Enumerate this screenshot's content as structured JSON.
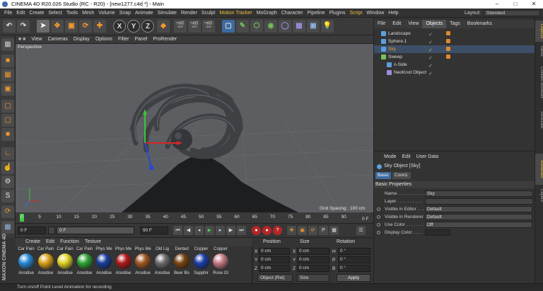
{
  "title": "CINEMA 4D R20.026 Studio (RC - R20) - [new1277.c4d *] - Main",
  "window_controls": {
    "min": "–",
    "max": "□",
    "close": "✕"
  },
  "menu": [
    "File",
    "Edit",
    "Create",
    "Select",
    "Tools",
    "Mesh",
    "Volume",
    "Snap",
    "Animate",
    "Simulate",
    "Render",
    "Sculpt",
    "Motion Tracker",
    "MoGraph",
    "Character",
    "Pipeline",
    "Plugins",
    "Script",
    "Window",
    "Help"
  ],
  "layout": {
    "label": "Layout:",
    "value": "Standard"
  },
  "viewport": {
    "menu": [
      "View",
      "Cameras",
      "Display",
      "Options",
      "Filter",
      "Panel",
      "ProRender"
    ],
    "camera": "Perspective",
    "grid_spacing": "Grid Spacing : 100 cm"
  },
  "timeline": {
    "ticks": [
      "0",
      "5",
      "10",
      "15",
      "20",
      "25",
      "30",
      "35",
      "40",
      "45",
      "50",
      "55",
      "60",
      "65",
      "70",
      "75",
      "80",
      "85",
      "90"
    ],
    "end_label": "0 F"
  },
  "transport": {
    "start": "0 F",
    "current": "0 F",
    "end": "90 F",
    "end2": "90 F"
  },
  "materials": {
    "menu": [
      "Create",
      "Edit",
      "Function",
      "Texture"
    ],
    "items": [
      {
        "top": "Car Pain",
        "bottom": "Anodise",
        "color": "#2a8ad6"
      },
      {
        "top": "Car Pain",
        "bottom": "Anodise",
        "color": "#d8a11a"
      },
      {
        "top": "Car Pain",
        "bottom": "Anodise",
        "color": "#e0d326"
      },
      {
        "top": "Car Pain",
        "bottom": "Anodise",
        "color": "#2fa535"
      },
      {
        "top": "Phys Me",
        "bottom": "Anodise",
        "color": "#1a3e9c"
      },
      {
        "top": "Phys Me",
        "bottom": "Anodise",
        "color": "#b01b1b"
      },
      {
        "top": "Phys Me",
        "bottom": "Anodise",
        "color": "#a25822"
      },
      {
        "top": "Old Lig",
        "bottom": "Anodise",
        "color": "#6d6d6d"
      },
      {
        "top": "Dented",
        "bottom": "Beer Bo",
        "color": "#7a4412"
      },
      {
        "top": "Copper",
        "bottom": "Sapphir",
        "color": "#1c3fa8"
      },
      {
        "top": "Copper",
        "bottom": "Rose Gl",
        "color": "#c47a86"
      }
    ]
  },
  "coords": {
    "headers": {
      "position": "Position",
      "size": "Size",
      "rotation": "Rotation"
    },
    "rows": [
      {
        "axis": "X",
        "pos": "0 cm",
        "size_axis": "X",
        "size": "0 cm",
        "rot_axis": "H",
        "rot": "0 °"
      },
      {
        "axis": "Y",
        "pos": "0 cm",
        "size_axis": "Y",
        "size": "0 cm",
        "rot_axis": "P",
        "rot": "0 °"
      },
      {
        "axis": "Z",
        "pos": "0 cm",
        "size_axis": "Z",
        "size": "0 cm",
        "rot_axis": "B",
        "rot": "0 °"
      }
    ],
    "mode": "Object (Rel)",
    "size_mode": "Size",
    "apply": "Apply"
  },
  "objects": {
    "menu": [
      "File",
      "Edit",
      "View",
      "Objects",
      "Tags",
      "Bookmarks"
    ],
    "active_tab": "Objects",
    "items": [
      {
        "name": "Landscape",
        "indent": 0,
        "icon_color": "#5aa0e0"
      },
      {
        "name": "Sphere.1",
        "indent": 0,
        "icon_color": "#5aa0e0"
      },
      {
        "name": "Sky",
        "indent": 0,
        "icon_color": "#5aa0e0",
        "selected": true
      },
      {
        "name": "Sweep",
        "indent": 0,
        "icon_color": "#78c25b"
      },
      {
        "name": "n-Side",
        "indent": 1,
        "icon_color": "#5aa0e0"
      },
      {
        "name": "NeoKnot Object",
        "indent": 1,
        "icon_color": "#9c8ce0"
      }
    ]
  },
  "attributes": {
    "menu": [
      "Mode",
      "Edit",
      "User Data"
    ],
    "object_title": "Sky Object [Sky]",
    "tabs": [
      "Basic",
      "Coord."
    ],
    "section": "Basic Properties",
    "fields": [
      {
        "label": "Name . . . . . . . . . . .",
        "value": "Sky",
        "type": "text"
      },
      {
        "label": "Layer . . . . . . . . . .",
        "value": "",
        "type": "text"
      },
      {
        "label": "Visible in Editor . . .",
        "value": "Default",
        "type": "dropdown"
      },
      {
        "label": "Visible in Renderer",
        "value": "Default",
        "type": "dropdown"
      },
      {
        "label": "Use Color . . . . . . .",
        "value": "Off",
        "type": "dropdown"
      },
      {
        "label": "Display Color . . . .",
        "value": "",
        "type": "color"
      }
    ]
  },
  "right_tabs": [
    "Objects",
    "Takes",
    "Content Browser",
    "Structure",
    "Attributes",
    "Layers"
  ],
  "brand": "MAXON CINEMA 4D",
  "status": "Turn on/off Point Level Animation for recording"
}
